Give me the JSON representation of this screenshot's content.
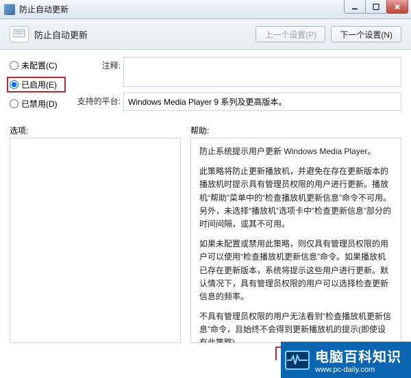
{
  "window": {
    "title": "防止自动更新"
  },
  "header": {
    "title": "防止自动更新",
    "prev_button": "上一个设置(P)",
    "next_button": "下一个设置(N)"
  },
  "radios": {
    "not_configured": "未配置(C)",
    "enabled": "已启用(E)",
    "disabled": "已禁用(D)"
  },
  "form": {
    "comment_label": "注释:",
    "comment_value": "",
    "platform_label": "支持的平台:",
    "platform_value": "Windows Media Player 9 系列及更高版本。"
  },
  "panes": {
    "options_label": "选项:",
    "help_label": "帮助:"
  },
  "help": {
    "p1": "防止系统提示用户更新 Windows Media Player。",
    "p2": "此策略将防止更新播放机，并避免在存在更新版本的播放机时提示具有管理员权限的用户进行更新。播放机“帮助”菜单中的“检查播放机更新信息”命令不可用。另外，未选择“播放机”选项卡中“检查更新信息”部分的时间间隔，或其不可用。",
    "p3": "如果未配置或禁用此策略，则仅具有管理员权限的用户可以使用“检查播放机更新信息”命令。如果播放机已存在更新版本，系统将提示这些用户进行更新。默认情况下，具有管理员权限的用户可以选择检查更新信息的频率。",
    "p4": "不具有管理员权限的用户无法看到“检查播放机更新信息”命令，且始终不会得到更新播放机的提示(即使设有此策略)。"
  },
  "watermark": {
    "main": "电脑百科知识",
    "sub": "www.pc-daily.com"
  }
}
